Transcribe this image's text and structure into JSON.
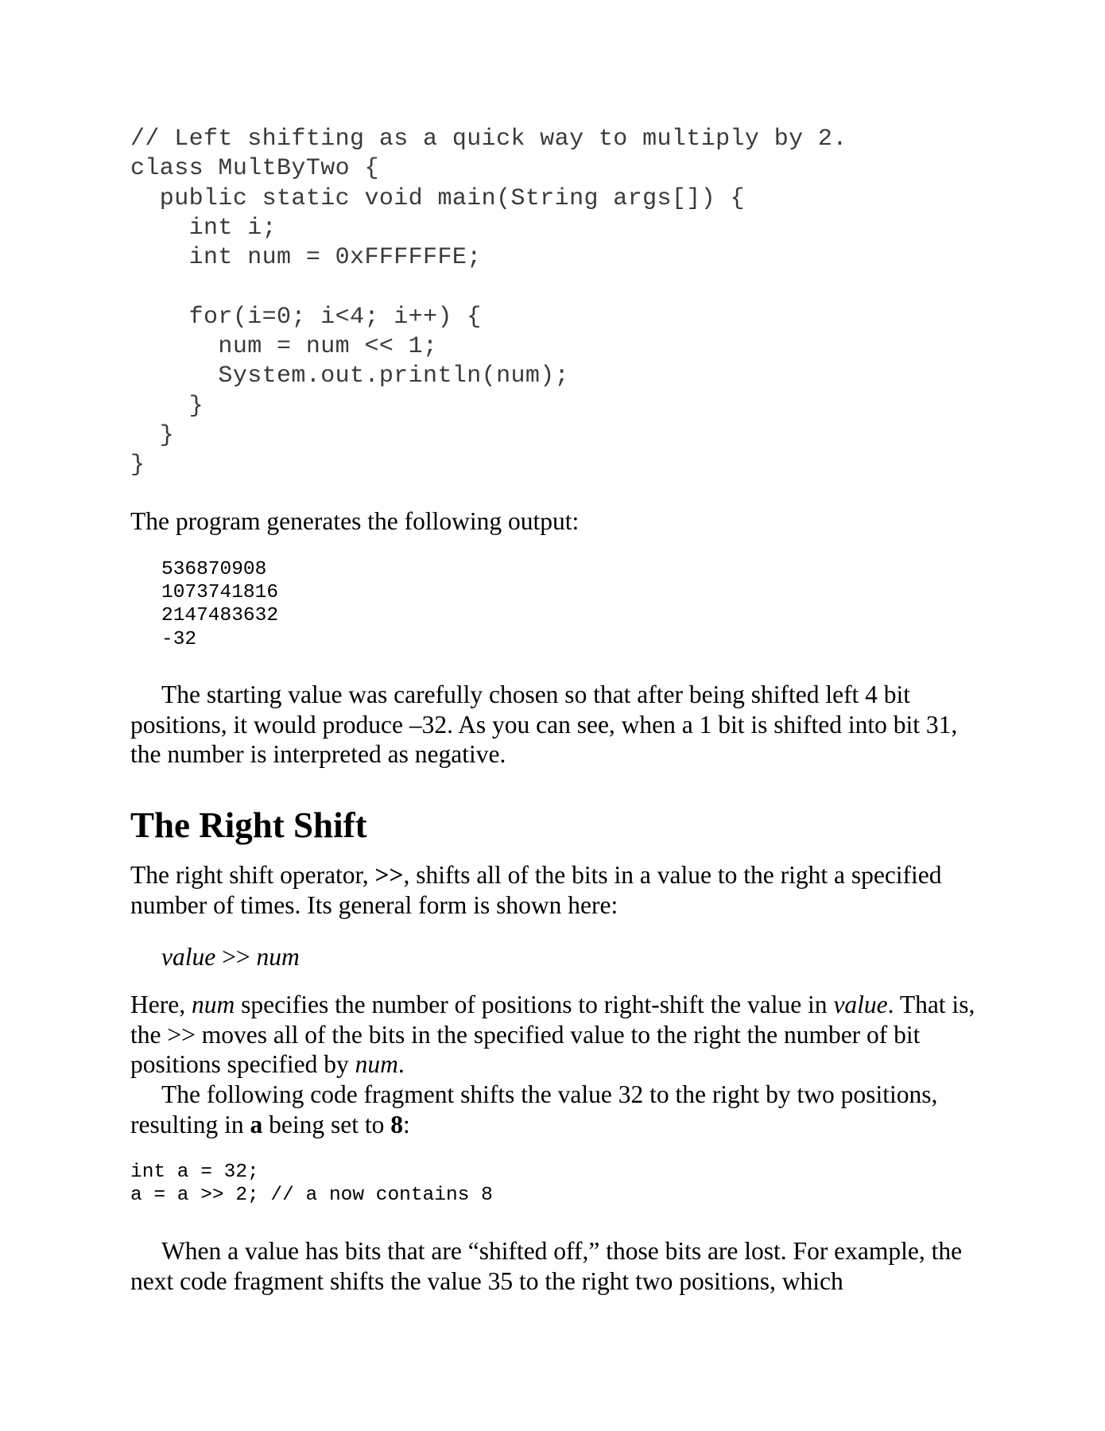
{
  "code_listing": {
    "lines": [
      "// Left shifting as a quick way to multiply by 2.",
      "class MultByTwo {",
      "  public static void main(String args[]) {",
      "    int i;",
      "    int num = 0xFFFFFFE;",
      "",
      "    for(i=0; i<4; i++) {",
      "      num = num << 1;",
      "      System.out.println(num);",
      "    }",
      "  }",
      "}"
    ]
  },
  "output_intro": "The program generates the following output:",
  "output_lines": [
    "536870908",
    "1073741816",
    "2147483632",
    "-32"
  ],
  "para_starting_value": "The starting value was carefully chosen so that after being shifted left 4 bit positions, it would produce –32. As you can see, when a 1 bit is shifted into bit 31, the number is interpreted as negative.",
  "section_heading": "The Right Shift",
  "right_shift_intro": {
    "t1": "The right shift operator, ",
    "op": ">>",
    "t2": ", shifts all of the bits in a value to the right a specified number of times. Its general form is shown here:"
  },
  "general_form": {
    "value": "value",
    "op": " >> ",
    "num": "num"
  },
  "explanation": {
    "t1": "Here, ",
    "num": "num",
    "t2": " specifies the number of positions to right-shift the value in ",
    "value": "value",
    "t3": ". That is, the >> moves all of the bits in the specified value to the right the number of bit positions specified by ",
    "num2": "num",
    "t4": "."
  },
  "fragment_intro": {
    "t1": "The following code fragment shifts the value 32 to the right by two positions, resulting in ",
    "a": "a",
    "t2": " being set to ",
    "eight": "8",
    "t3": ":"
  },
  "fragment_lines": [
    "int a = 32;",
    "a = a >> 2; // a now contains 8"
  ],
  "shifted_off_para": "When a value has bits that are “shifted off,” those bits are lost. For example, the next code fragment shifts the value 35 to the right two positions, which"
}
